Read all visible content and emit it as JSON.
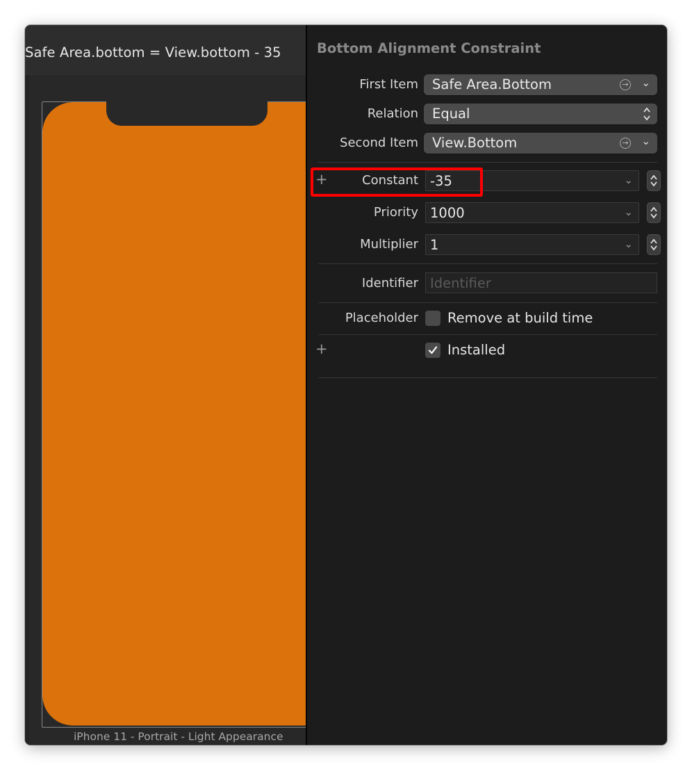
{
  "canvas": {
    "constraint_title": "Safe Area.bottom = View.bottom - 35",
    "device_caption": "iPhone 11 - Portrait - Light Appearance"
  },
  "inspector": {
    "title": "Bottom Alignment Constraint",
    "first_item": {
      "label": "First Item",
      "value": "Safe Area.Bottom"
    },
    "relation": {
      "label": "Relation",
      "value": "Equal"
    },
    "second_item": {
      "label": "Second Item",
      "value": "View.Bottom"
    },
    "constant": {
      "label": "Constant",
      "value": "-35"
    },
    "priority": {
      "label": "Priority",
      "value": "1000"
    },
    "multiplier": {
      "label": "Multiplier",
      "value": "1"
    },
    "identifier": {
      "label": "Identifier",
      "placeholder": "Identifier",
      "value": ""
    },
    "placeholder": {
      "label": "Placeholder",
      "checkbox_label": "Remove at build time",
      "checked": false
    },
    "installed": {
      "checkbox_label": "Installed",
      "checked": true
    }
  },
  "colors": {
    "device_screen": "#dc720b",
    "highlight_box": "#ff0000",
    "inspector_bg": "#1c1c1c",
    "canvas_bg": "#282828"
  }
}
